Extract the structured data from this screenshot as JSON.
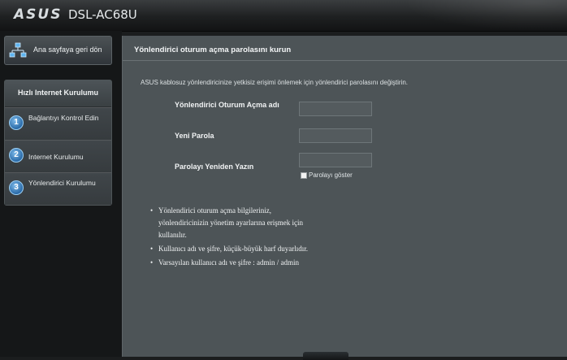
{
  "header": {
    "logo": "ASUS",
    "model": "DSL-AC68U"
  },
  "sidebar": {
    "home_label": "Ana sayfaya geri dön",
    "steps_title": "Hızlı Internet Kurulumu",
    "steps": [
      {
        "number": "1",
        "label": "Bağlantıyı Kontrol Edin"
      },
      {
        "number": "2",
        "label": "Internet Kurulumu"
      },
      {
        "number": "3",
        "label": "Yönlendirici Kurulumu"
      }
    ]
  },
  "main": {
    "title": "Yönlendirici oturum açma parolasını kurun",
    "description": "ASUS kablosuz yönlendiricinize yetkisiz erişimi önlemek için yönlendirici parolasını değiştirin.",
    "fields": {
      "login_name_label": "Yönlendirici Oturum Açma adı",
      "login_name_value": "",
      "new_password_label": "Yeni Parola",
      "new_password_value": "",
      "retype_label": "Parolayı Yeniden Yazın",
      "retype_value": ""
    },
    "show_password_label": "Parolayı göster",
    "notes": [
      "Yönlendirici oturum açma bilgileriniz, yönlendiricinizin yönetim ayarlarına erişmek için kullanılır.",
      "Kullanıcı adı ve şifre, küçük-büyük harf duyarlıdır.",
      "Varsayılan kullanıcı adı ve şifre : admin / admin"
    ]
  },
  "colors": {
    "accent": "#2a6aa8",
    "panel_bg": "#4d5457",
    "sidebar_bg": "#151718"
  }
}
